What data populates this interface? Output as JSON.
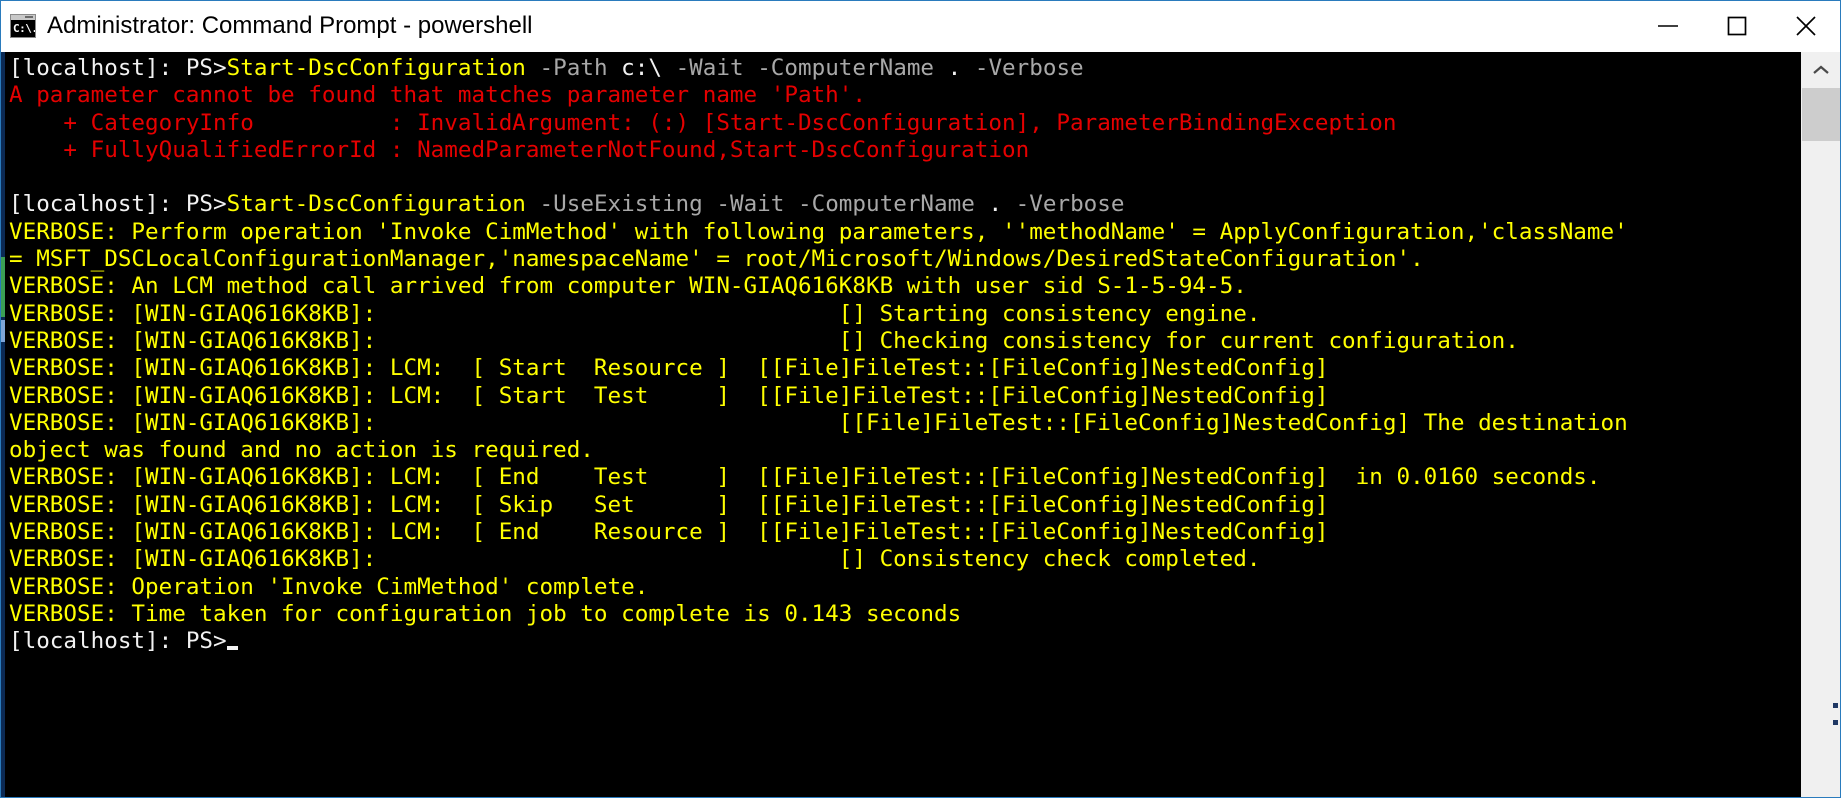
{
  "window": {
    "title": "Administrator: Command Prompt - powershell",
    "icon_label": "C:\\.",
    "icon_name": "command-prompt-icon",
    "controls": {
      "minimize": "Minimize",
      "maximize": "Maximize",
      "close": "Close"
    },
    "accent_color": "#2a7bbd"
  },
  "colors": {
    "background": "#000000",
    "prompt_text": "#f2f2f2",
    "command": "#ffff00",
    "parameter": "#a8a8a8",
    "error": "#e50000",
    "verbose": "#ffff00"
  },
  "console": {
    "lines": [
      {
        "id": "prompt-line-1",
        "segments": [
          {
            "text": "[localhost]: PS>",
            "style": "white"
          },
          {
            "text": "Start-DscConfiguration",
            "style": "cmd"
          },
          {
            "text": " ",
            "style": "white"
          },
          {
            "text": "-Path",
            "style": "gray"
          },
          {
            "text": " c:\\ ",
            "style": "white"
          },
          {
            "text": "-Wait",
            "style": "gray"
          },
          {
            "text": " ",
            "style": "white"
          },
          {
            "text": "-ComputerName",
            "style": "gray"
          },
          {
            "text": " . ",
            "style": "white"
          },
          {
            "text": "-Verbose",
            "style": "gray"
          }
        ]
      },
      {
        "id": "error-line-1",
        "segments": [
          {
            "text": "A parameter cannot be found that matches parameter name 'Path'.",
            "style": "red"
          }
        ]
      },
      {
        "id": "error-line-2",
        "segments": [
          {
            "text": "    + CategoryInfo          : InvalidArgument: (:) [Start-DscConfiguration], ParameterBindingException",
            "style": "red"
          }
        ]
      },
      {
        "id": "error-line-3",
        "segments": [
          {
            "text": "    + FullyQualifiedErrorId : NamedParameterNotFound,Start-DscConfiguration",
            "style": "red"
          }
        ]
      },
      {
        "id": "blank-line-1",
        "segments": [
          {
            "text": " ",
            "style": "white"
          }
        ]
      },
      {
        "id": "prompt-line-2",
        "segments": [
          {
            "text": "[localhost]: PS>",
            "style": "white"
          },
          {
            "text": "Start-DscConfiguration",
            "style": "cmd"
          },
          {
            "text": " ",
            "style": "white"
          },
          {
            "text": "-UseExisting",
            "style": "gray"
          },
          {
            "text": " ",
            "style": "white"
          },
          {
            "text": "-Wait",
            "style": "gray"
          },
          {
            "text": " ",
            "style": "white"
          },
          {
            "text": "-ComputerName",
            "style": "gray"
          },
          {
            "text": " . ",
            "style": "white"
          },
          {
            "text": "-Verbose",
            "style": "gray"
          }
        ]
      },
      {
        "id": "verbose-line-1",
        "segments": [
          {
            "text": "VERBOSE: Perform operation 'Invoke CimMethod' with following parameters, ''methodName' = ApplyConfiguration,'className'",
            "style": "yellow"
          }
        ]
      },
      {
        "id": "verbose-line-2",
        "segments": [
          {
            "text": "= MSFT_DSCLocalConfigurationManager,'namespaceName' = root/Microsoft/Windows/DesiredStateConfiguration'.",
            "style": "yellow"
          }
        ]
      },
      {
        "id": "verbose-line-3",
        "segments": [
          {
            "text": "VERBOSE: An LCM method call arrived from computer WIN-GIAQ616K8KB with user sid S-1-5-94-5.",
            "style": "yellow"
          }
        ]
      },
      {
        "id": "verbose-line-4",
        "segments": [
          {
            "text": "VERBOSE: [WIN-GIAQ616K8KB]:                                  [] Starting consistency engine.",
            "style": "yellow"
          }
        ]
      },
      {
        "id": "verbose-line-5",
        "segments": [
          {
            "text": "VERBOSE: [WIN-GIAQ616K8KB]:                                  [] Checking consistency for current configuration.",
            "style": "yellow"
          }
        ]
      },
      {
        "id": "verbose-line-6",
        "segments": [
          {
            "text": "VERBOSE: [WIN-GIAQ616K8KB]: LCM:  [ Start  Resource ]  [[File]FileTest::[FileConfig]NestedConfig]",
            "style": "yellow"
          }
        ]
      },
      {
        "id": "verbose-line-7",
        "segments": [
          {
            "text": "VERBOSE: [WIN-GIAQ616K8KB]: LCM:  [ Start  Test     ]  [[File]FileTest::[FileConfig]NestedConfig]",
            "style": "yellow"
          }
        ]
      },
      {
        "id": "verbose-line-8",
        "segments": [
          {
            "text": "VERBOSE: [WIN-GIAQ616K8KB]:                                  [[File]FileTest::[FileConfig]NestedConfig] The destination",
            "style": "yellow"
          }
        ]
      },
      {
        "id": "verbose-line-9",
        "segments": [
          {
            "text": "object was found and no action is required.",
            "style": "yellow"
          }
        ]
      },
      {
        "id": "verbose-line-10",
        "segments": [
          {
            "text": "VERBOSE: [WIN-GIAQ616K8KB]: LCM:  [ End    Test     ]  [[File]FileTest::[FileConfig]NestedConfig]  in 0.0160 seconds.",
            "style": "yellow"
          }
        ]
      },
      {
        "id": "verbose-line-11",
        "segments": [
          {
            "text": "VERBOSE: [WIN-GIAQ616K8KB]: LCM:  [ Skip   Set      ]  [[File]FileTest::[FileConfig]NestedConfig]",
            "style": "yellow"
          }
        ]
      },
      {
        "id": "verbose-line-12",
        "segments": [
          {
            "text": "VERBOSE: [WIN-GIAQ616K8KB]: LCM:  [ End    Resource ]  [[File]FileTest::[FileConfig]NestedConfig]",
            "style": "yellow"
          }
        ]
      },
      {
        "id": "verbose-line-13",
        "segments": [
          {
            "text": "VERBOSE: [WIN-GIAQ616K8KB]:                                  [] Consistency check completed.",
            "style": "yellow"
          }
        ]
      },
      {
        "id": "verbose-line-14",
        "segments": [
          {
            "text": "VERBOSE: Operation 'Invoke CimMethod' complete.",
            "style": "yellow"
          }
        ]
      },
      {
        "id": "verbose-line-15",
        "segments": [
          {
            "text": "VERBOSE: Time taken for configuration job to complete is 0.143 seconds",
            "style": "yellow"
          }
        ]
      },
      {
        "id": "prompt-line-3",
        "segments": [
          {
            "text": "[localhost]: PS>",
            "style": "white"
          }
        ],
        "cursor": true
      }
    ]
  },
  "scrollbar": {
    "up_arrow": "scroll-up",
    "down_arrow": "scroll-down",
    "thumb_label": "scroll-thumb"
  }
}
